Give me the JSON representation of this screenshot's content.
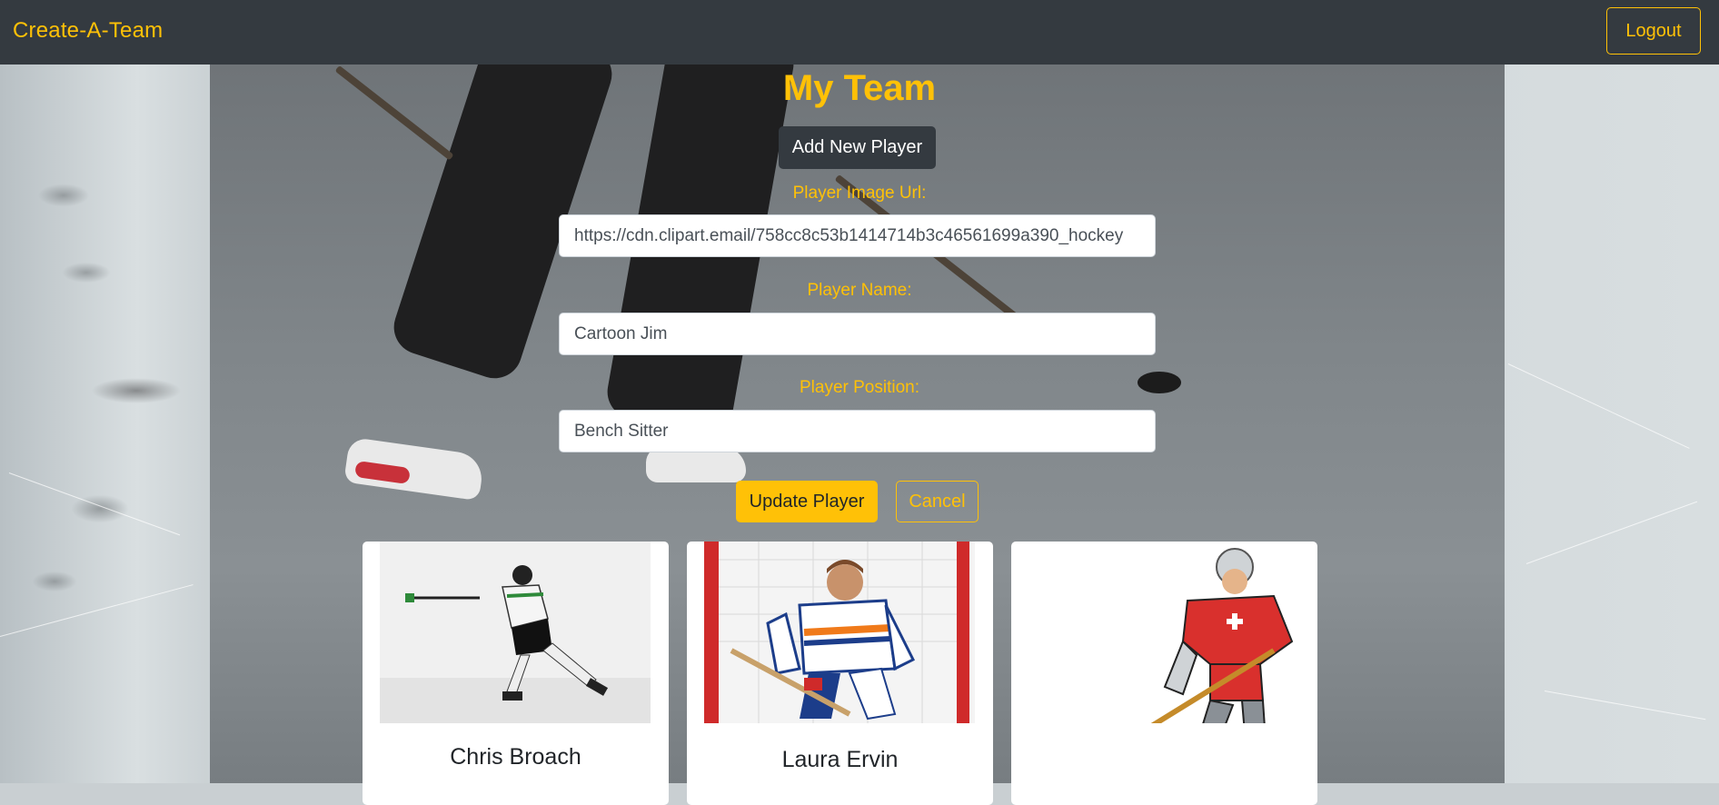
{
  "navbar": {
    "brand": "Create-A-Team",
    "logout_label": "Logout"
  },
  "page": {
    "title": "My Team",
    "add_player_label": "Add New Player"
  },
  "form": {
    "image_url_label": "Player Image Url:",
    "image_url_value": "https://cdn.clipart.email/758cc8c53b1414714b3c46561699a390_hockey",
    "name_label": "Player Name:",
    "name_value": "Cartoon Jim",
    "position_label": "Player Position:",
    "position_value": "Bench Sitter",
    "update_label": "Update Player",
    "cancel_label": "Cancel"
  },
  "players": [
    {
      "name": "Chris Broach",
      "image_icon": "hockey-player-photo-icon"
    },
    {
      "name": "Laura Ervin",
      "image_icon": "hockey-player-photo-icon"
    },
    {
      "name": "",
      "image_icon": "cartoon-hockey-player-icon"
    }
  ],
  "colors": {
    "accent": "#ffc107",
    "navbar": "#343a40",
    "dark_button": "#343a40"
  }
}
